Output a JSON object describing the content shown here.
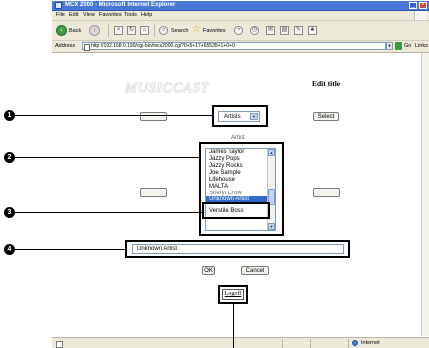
{
  "window": {
    "title": "MCX 2000 - Microsoft Internet Explorer"
  },
  "menubar": {
    "items": [
      "File",
      "Edit",
      "View",
      "Favorites",
      "Tools",
      "Help"
    ]
  },
  "toolbar": {
    "back_label": "Back",
    "search_label": "Search",
    "favorites_label": "Favorites"
  },
  "addressbar": {
    "label": "Address",
    "url": "http://192.168.0.190/cgi-bin/mcx2000.cgi?0+5+17+65535+1+0+0",
    "go_label": "Go",
    "links_label": "Links"
  },
  "statusbar": {
    "zone": "Internet"
  },
  "page": {
    "logo_text": "MUSICCAST",
    "heading": "Edit title",
    "category_select": {
      "value": "Artists"
    },
    "select_button": "Select",
    "list_caption": "Artist",
    "list_items": [
      {
        "label": "James Taylor",
        "selected": false
      },
      {
        "label": "Jazzy Pops",
        "selected": false
      },
      {
        "label": "Jazzy Rocks",
        "selected": false
      },
      {
        "label": "Joe Sample",
        "selected": false
      },
      {
        "label": "Lifehouse",
        "selected": false
      },
      {
        "label": "MALTA",
        "selected": false
      },
      {
        "label": "Sheryl Crow",
        "selected": false
      },
      {
        "label": "Unknown Artist",
        "selected": true
      },
      {
        "label": "Verstile Boss",
        "selected": false
      }
    ],
    "title_input": {
      "value": "Unknown Artist"
    },
    "ok_button": "OK",
    "cancel_button": "Cancel",
    "logout_link": "Logoff"
  },
  "callouts": [
    "1",
    "2",
    "3",
    "4"
  ]
}
